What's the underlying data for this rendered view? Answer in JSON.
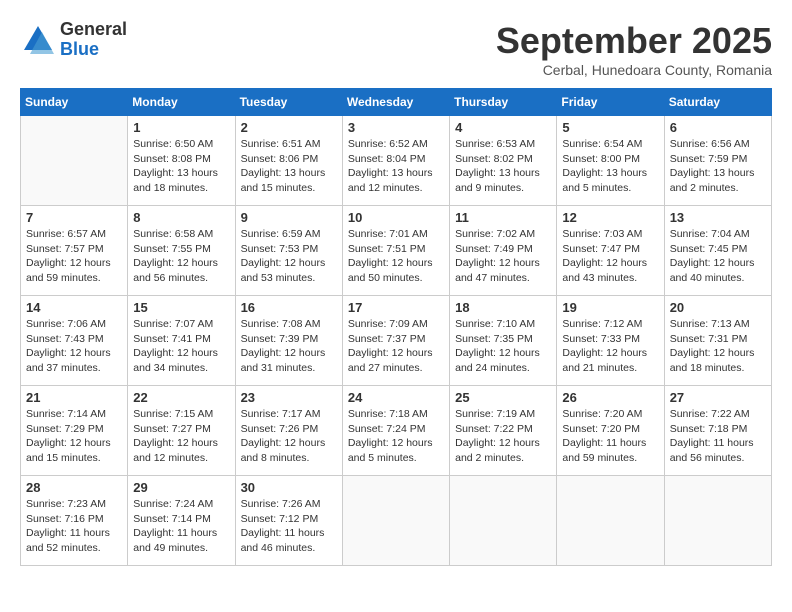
{
  "header": {
    "logo_general": "General",
    "logo_blue": "Blue",
    "month_title": "September 2025",
    "subtitle": "Cerbal, Hunedoara County, Romania"
  },
  "days_of_week": [
    "Sunday",
    "Monday",
    "Tuesday",
    "Wednesday",
    "Thursday",
    "Friday",
    "Saturday"
  ],
  "weeks": [
    [
      {
        "day": "",
        "info": ""
      },
      {
        "day": "1",
        "info": "Sunrise: 6:50 AM\nSunset: 8:08 PM\nDaylight: 13 hours\nand 18 minutes."
      },
      {
        "day": "2",
        "info": "Sunrise: 6:51 AM\nSunset: 8:06 PM\nDaylight: 13 hours\nand 15 minutes."
      },
      {
        "day": "3",
        "info": "Sunrise: 6:52 AM\nSunset: 8:04 PM\nDaylight: 13 hours\nand 12 minutes."
      },
      {
        "day": "4",
        "info": "Sunrise: 6:53 AM\nSunset: 8:02 PM\nDaylight: 13 hours\nand 9 minutes."
      },
      {
        "day": "5",
        "info": "Sunrise: 6:54 AM\nSunset: 8:00 PM\nDaylight: 13 hours\nand 5 minutes."
      },
      {
        "day": "6",
        "info": "Sunrise: 6:56 AM\nSunset: 7:59 PM\nDaylight: 13 hours\nand 2 minutes."
      }
    ],
    [
      {
        "day": "7",
        "info": "Sunrise: 6:57 AM\nSunset: 7:57 PM\nDaylight: 12 hours\nand 59 minutes."
      },
      {
        "day": "8",
        "info": "Sunrise: 6:58 AM\nSunset: 7:55 PM\nDaylight: 12 hours\nand 56 minutes."
      },
      {
        "day": "9",
        "info": "Sunrise: 6:59 AM\nSunset: 7:53 PM\nDaylight: 12 hours\nand 53 minutes."
      },
      {
        "day": "10",
        "info": "Sunrise: 7:01 AM\nSunset: 7:51 PM\nDaylight: 12 hours\nand 50 minutes."
      },
      {
        "day": "11",
        "info": "Sunrise: 7:02 AM\nSunset: 7:49 PM\nDaylight: 12 hours\nand 47 minutes."
      },
      {
        "day": "12",
        "info": "Sunrise: 7:03 AM\nSunset: 7:47 PM\nDaylight: 12 hours\nand 43 minutes."
      },
      {
        "day": "13",
        "info": "Sunrise: 7:04 AM\nSunset: 7:45 PM\nDaylight: 12 hours\nand 40 minutes."
      }
    ],
    [
      {
        "day": "14",
        "info": "Sunrise: 7:06 AM\nSunset: 7:43 PM\nDaylight: 12 hours\nand 37 minutes."
      },
      {
        "day": "15",
        "info": "Sunrise: 7:07 AM\nSunset: 7:41 PM\nDaylight: 12 hours\nand 34 minutes."
      },
      {
        "day": "16",
        "info": "Sunrise: 7:08 AM\nSunset: 7:39 PM\nDaylight: 12 hours\nand 31 minutes."
      },
      {
        "day": "17",
        "info": "Sunrise: 7:09 AM\nSunset: 7:37 PM\nDaylight: 12 hours\nand 27 minutes."
      },
      {
        "day": "18",
        "info": "Sunrise: 7:10 AM\nSunset: 7:35 PM\nDaylight: 12 hours\nand 24 minutes."
      },
      {
        "day": "19",
        "info": "Sunrise: 7:12 AM\nSunset: 7:33 PM\nDaylight: 12 hours\nand 21 minutes."
      },
      {
        "day": "20",
        "info": "Sunrise: 7:13 AM\nSunset: 7:31 PM\nDaylight: 12 hours\nand 18 minutes."
      }
    ],
    [
      {
        "day": "21",
        "info": "Sunrise: 7:14 AM\nSunset: 7:29 PM\nDaylight: 12 hours\nand 15 minutes."
      },
      {
        "day": "22",
        "info": "Sunrise: 7:15 AM\nSunset: 7:27 PM\nDaylight: 12 hours\nand 12 minutes."
      },
      {
        "day": "23",
        "info": "Sunrise: 7:17 AM\nSunset: 7:26 PM\nDaylight: 12 hours\nand 8 minutes."
      },
      {
        "day": "24",
        "info": "Sunrise: 7:18 AM\nSunset: 7:24 PM\nDaylight: 12 hours\nand 5 minutes."
      },
      {
        "day": "25",
        "info": "Sunrise: 7:19 AM\nSunset: 7:22 PM\nDaylight: 12 hours\nand 2 minutes."
      },
      {
        "day": "26",
        "info": "Sunrise: 7:20 AM\nSunset: 7:20 PM\nDaylight: 11 hours\nand 59 minutes."
      },
      {
        "day": "27",
        "info": "Sunrise: 7:22 AM\nSunset: 7:18 PM\nDaylight: 11 hours\nand 56 minutes."
      }
    ],
    [
      {
        "day": "28",
        "info": "Sunrise: 7:23 AM\nSunset: 7:16 PM\nDaylight: 11 hours\nand 52 minutes."
      },
      {
        "day": "29",
        "info": "Sunrise: 7:24 AM\nSunset: 7:14 PM\nDaylight: 11 hours\nand 49 minutes."
      },
      {
        "day": "30",
        "info": "Sunrise: 7:26 AM\nSunset: 7:12 PM\nDaylight: 11 hours\nand 46 minutes."
      },
      {
        "day": "",
        "info": ""
      },
      {
        "day": "",
        "info": ""
      },
      {
        "day": "",
        "info": ""
      },
      {
        "day": "",
        "info": ""
      }
    ]
  ]
}
